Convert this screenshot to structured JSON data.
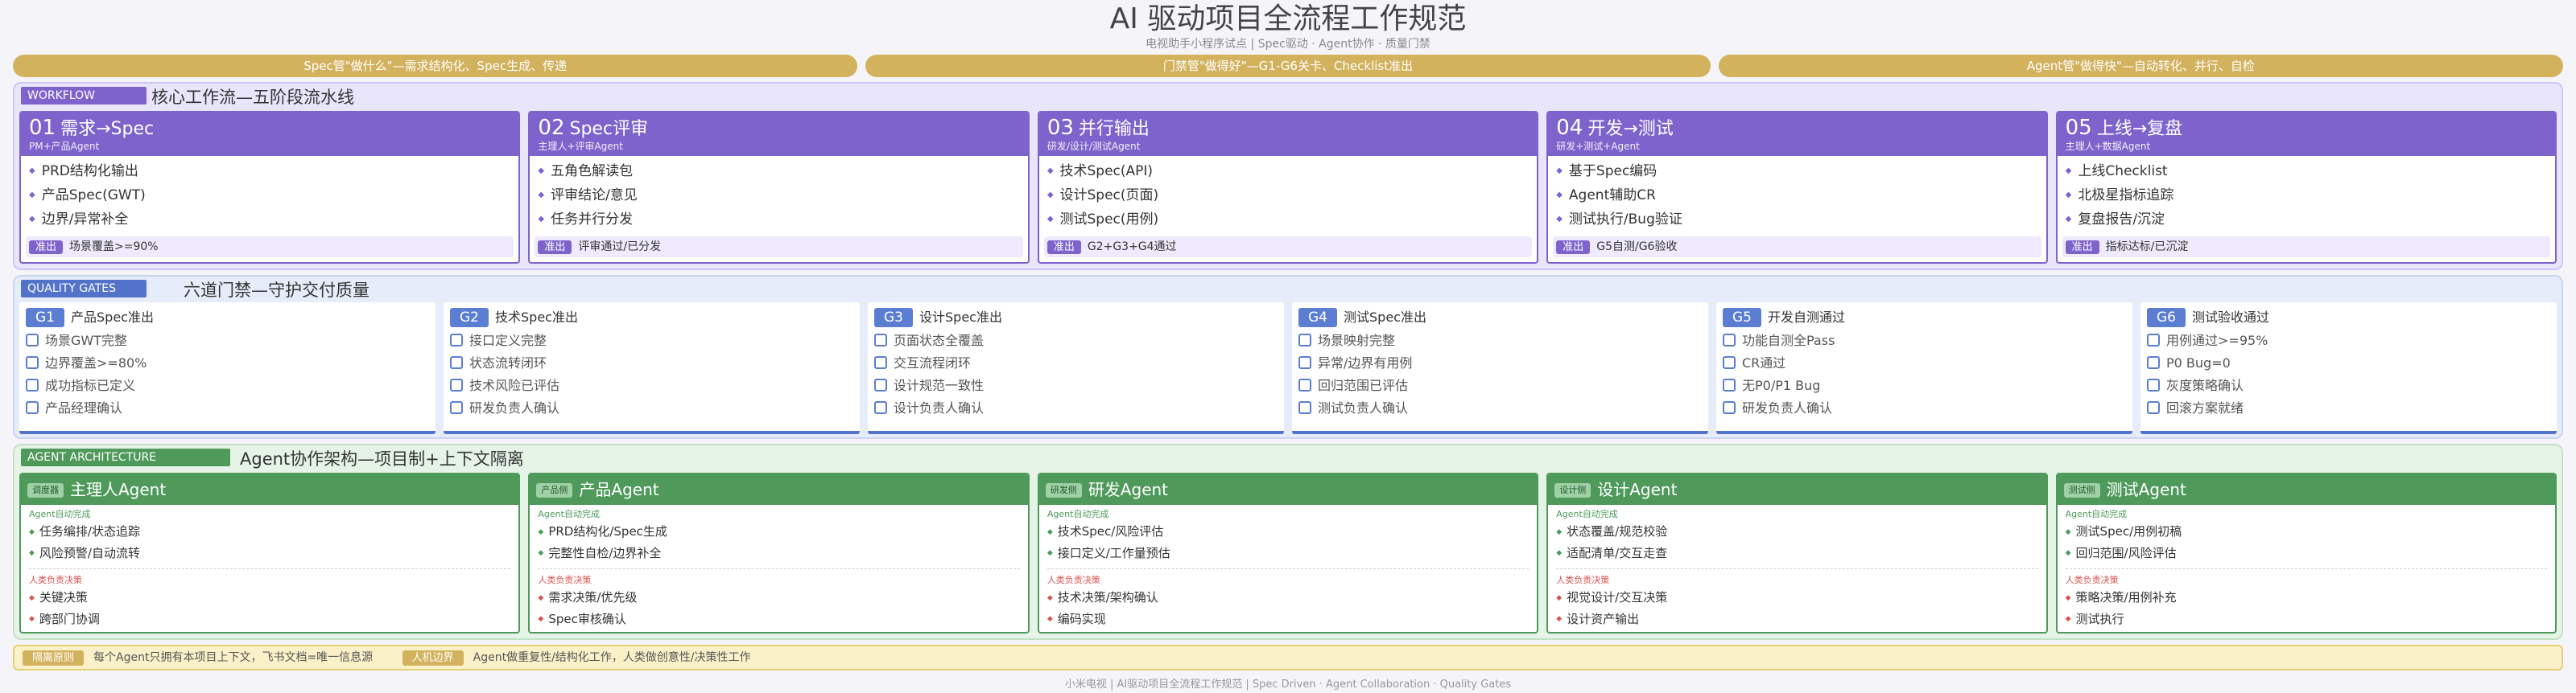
{
  "header": {
    "title": "AI 驱动项目全流程工作规范",
    "subtitle": "电视助手小程序试点 | Spec驱动 · Agent协作 · 质量门禁"
  },
  "banners": [
    "Spec管\"做什么\"—需求结构化、Spec生成、传递",
    "门禁管\"做得好\"—G1-G6关卡、Checklist准出",
    "Agent管\"做得快\"—自动转化、并行、自检"
  ],
  "workflow": {
    "tag": "WORKFLOW",
    "title": "核心工作流—五阶段流水线",
    "exit_chip": "准出",
    "stages": [
      {
        "num": "01",
        "name": "需求→Spec",
        "role": "PM+产品Agent",
        "items": [
          "PRD结构化输出",
          "产品Spec(GWT)",
          "边界/异常补全"
        ],
        "exit": "场景覆盖>=90%"
      },
      {
        "num": "02",
        "name": "Spec评审",
        "role": "主理人+评审Agent",
        "items": [
          "五角色解读包",
          "评审结论/意见",
          "任务并行分发"
        ],
        "exit": "评审通过/已分发"
      },
      {
        "num": "03",
        "name": "并行输出",
        "role": "研发/设计/测试Agent",
        "items": [
          "技术Spec(API)",
          "设计Spec(页面)",
          "测试Spec(用例)"
        ],
        "exit": "G2+G3+G4通过"
      },
      {
        "num": "04",
        "name": "开发→测试",
        "role": "研发+测试+Agent",
        "items": [
          "基于Spec编码",
          "Agent辅助CR",
          "测试执行/Bug验证"
        ],
        "exit": "G5自测/G6验收"
      },
      {
        "num": "05",
        "name": "上线→复盘",
        "role": "主理人+数据Agent",
        "items": [
          "上线Checklist",
          "北极星指标追踪",
          "复盘报告/沉淀"
        ],
        "exit": "指标达标/已沉淀"
      }
    ]
  },
  "quality": {
    "tag": "QUALITY GATES",
    "title": "六道门禁—守护交付质量",
    "gates": [
      {
        "id": "G1",
        "name": "产品Spec准出",
        "items": [
          "场景GWT完整",
          "边界覆盖>=80%",
          "成功指标已定义",
          "产品经理确认"
        ]
      },
      {
        "id": "G2",
        "name": "技术Spec准出",
        "items": [
          "接口定义完整",
          "状态流转闭环",
          "技术风险已评估",
          "研发负责人确认"
        ]
      },
      {
        "id": "G3",
        "name": "设计Spec准出",
        "items": [
          "页面状态全覆盖",
          "交互流程闭环",
          "设计规范一致性",
          "设计负责人确认"
        ]
      },
      {
        "id": "G4",
        "name": "测试Spec准出",
        "items": [
          "场景映射完整",
          "异常/边界有用例",
          "回归范围已评估",
          "测试负责人确认"
        ]
      },
      {
        "id": "G5",
        "name": "开发自测通过",
        "items": [
          "功能自测全Pass",
          "CR通过",
          "无P0/P1 Bug",
          "研发负责人确认"
        ]
      },
      {
        "id": "G6",
        "name": "测试验收通过",
        "items": [
          "用例通过>=95%",
          "P0 Bug=0",
          "灰度策略确认",
          "回滚方案就绪"
        ]
      }
    ]
  },
  "agents": {
    "tag": "AGENT ARCHITECTURE",
    "title": "Agent协作架构—项目制+上下文隔离",
    "auto_label": "Agent自动完成",
    "human_label": "人类负责决策",
    "list": [
      {
        "badge": "调度器",
        "name": "主理人Agent",
        "auto": [
          "任务编排/状态追踪",
          "风险预警/自动流转"
        ],
        "human": [
          "关键决策",
          "跨部门协调"
        ]
      },
      {
        "badge": "产品侧",
        "name": "产品Agent",
        "auto": [
          "PRD结构化/Spec生成",
          "完整性自检/边界补全"
        ],
        "human": [
          "需求决策/优先级",
          "Spec审核确认"
        ]
      },
      {
        "badge": "研发侧",
        "name": "研发Agent",
        "auto": [
          "技术Spec/风险评估",
          "接口定义/工作量预估"
        ],
        "human": [
          "技术决策/架构确认",
          "编码实现"
        ]
      },
      {
        "badge": "设计侧",
        "name": "设计Agent",
        "auto": [
          "状态覆盖/规范校验",
          "适配清单/交互走查"
        ],
        "human": [
          "视觉设计/交互决策",
          "设计资产输出"
        ]
      },
      {
        "badge": "测试侧",
        "name": "测试Agent",
        "auto": [
          "测试Spec/用例初稿",
          "回归范围/风险评估"
        ],
        "human": [
          "策略决策/用例补充",
          "测试执行"
        ]
      }
    ]
  },
  "footer": {
    "chip1": "隔离原则",
    "text1": "每个Agent只拥有本项目上下文，飞书文档=唯一信息源",
    "chip2": "人机边界",
    "text2": "Agent做重复性/结构化工作，人类做创意性/决策性工作"
  },
  "copyright": "小米电视 | AI驱动项目全流程工作规范 | Spec Driven · Agent Collaboration · Quality Gates",
  "colors": {
    "workflow": "#7e63cc",
    "quality": "#5273c9",
    "agent": "#4f9a5b",
    "gold": "#d3b25e"
  }
}
